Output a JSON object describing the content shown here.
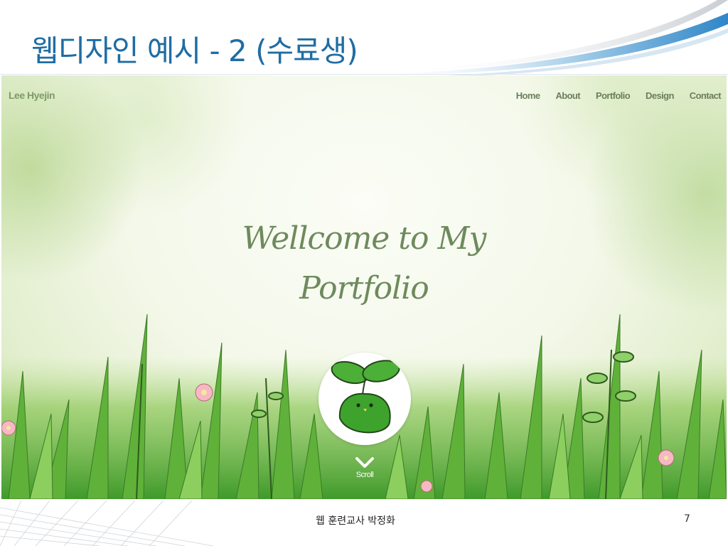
{
  "slide": {
    "title": "웹디자인 예시 - 2 (수료생)",
    "footer": "웹 훈련교사 박정화",
    "page_number": "7",
    "accent_color": "#1f6da3"
  },
  "site": {
    "brand": "Lee Hyejin",
    "nav": [
      "Home",
      "About",
      "Portfolio",
      "Design",
      "Contact"
    ],
    "hero_line1": "Wellcome to My",
    "hero_line2": "Portfolio",
    "scroll_label": "Scroll",
    "scroll_icon": "chevron-down-icon",
    "mascot": "sprout-mascot",
    "theme_green": "#5aa83a"
  }
}
